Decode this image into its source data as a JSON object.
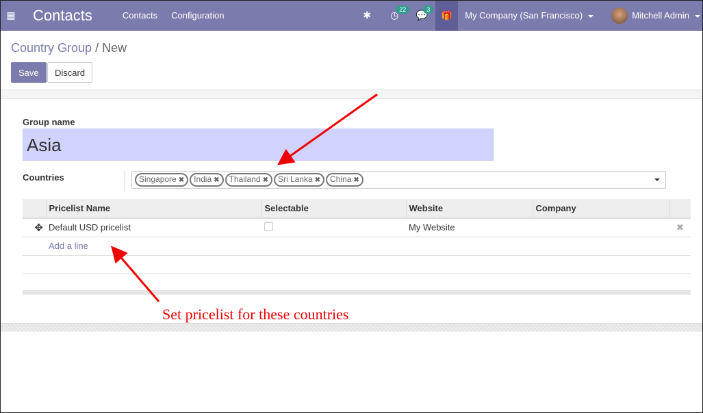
{
  "navbar": {
    "app_title": "Contacts",
    "menus": [
      "Contacts",
      "Configuration"
    ],
    "activity_count": "22",
    "message_count": "3",
    "company": "My Company (San Francisco)",
    "user": "Mitchell Admin",
    "color": "#7c7bad"
  },
  "breadcrumb": {
    "parent": "Country Group",
    "current": "New",
    "separator": "/"
  },
  "buttons": {
    "save": "Save",
    "discard": "Discard"
  },
  "form": {
    "group_name_label": "Group name",
    "group_name_value": "Asia",
    "countries_label": "Countries",
    "countries": [
      "Singapore",
      "India",
      "Thailand",
      "Sri Lanka",
      "China"
    ]
  },
  "table": {
    "columns": [
      "Pricelist Name",
      "Selectable",
      "Website",
      "Company"
    ],
    "rows": [
      {
        "name": "Default USD pricelist",
        "selectable": false,
        "website": "My Website",
        "company": ""
      }
    ],
    "add_line": "Add a line"
  },
  "annotation": {
    "text": "Set pricelist for these countries",
    "color": "#ee0000"
  }
}
